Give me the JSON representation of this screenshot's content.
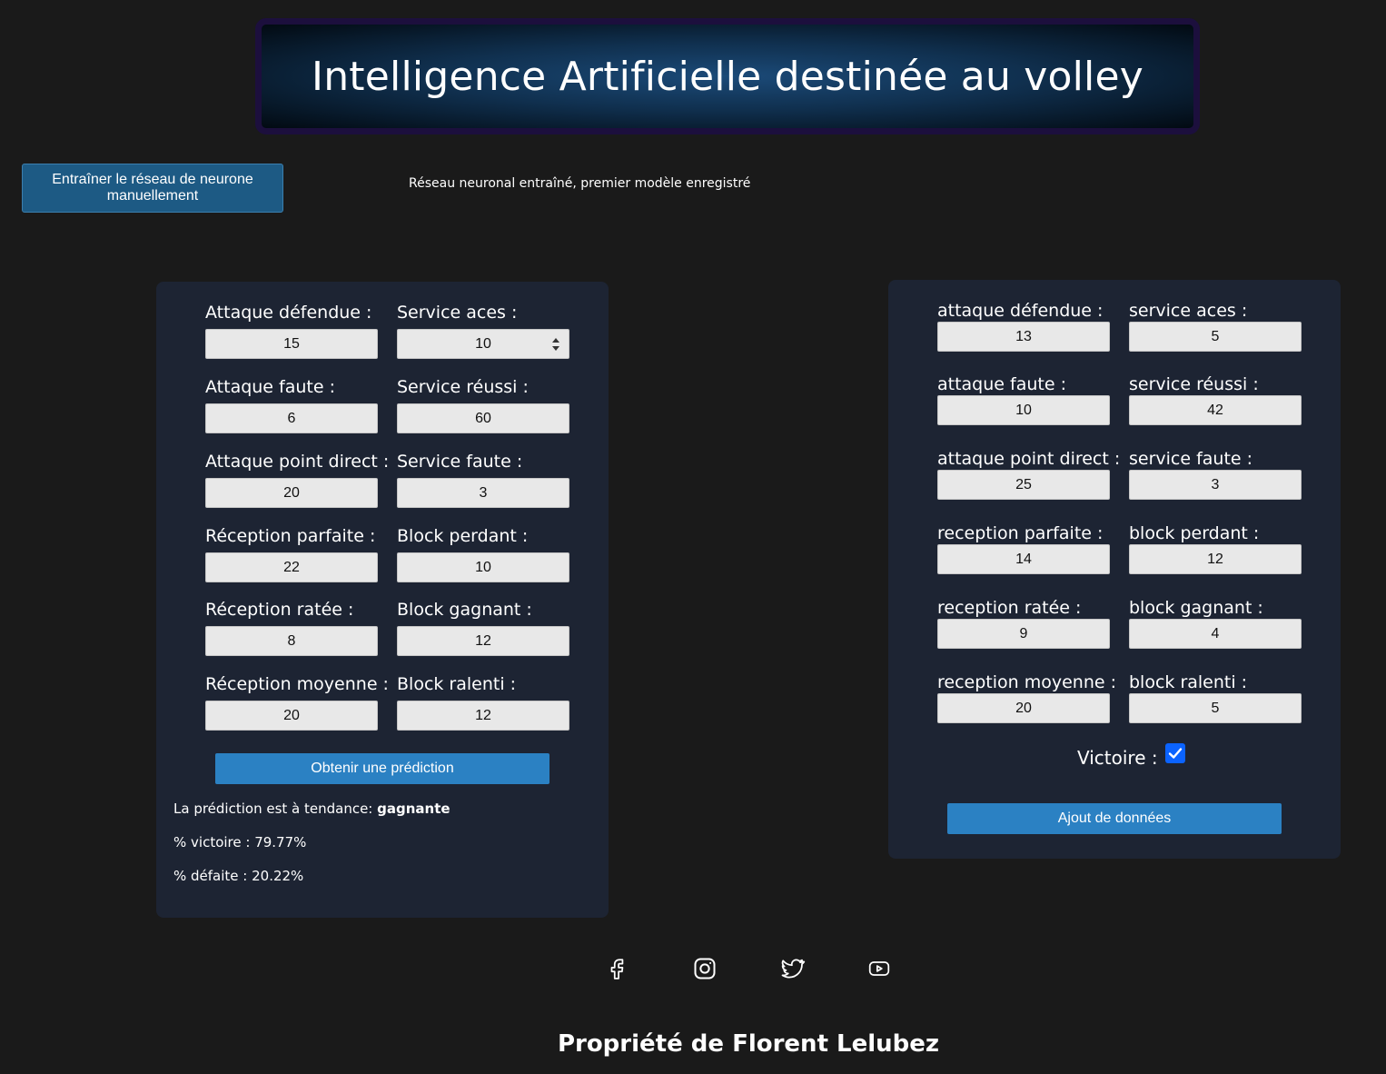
{
  "header": {
    "title": "Intelligence Artificielle destinée au volley"
  },
  "train_button": {
    "label": "Entraîner le réseau de neurone manuellement"
  },
  "status_text": "Réseau neuronal entraîné, premier modèle enregistré",
  "prediction_form": {
    "fields": [
      {
        "label": "Attaque défendue :",
        "value": "15"
      },
      {
        "label": "Service aces :",
        "value": "10"
      },
      {
        "label": "Attaque faute :",
        "value": "6"
      },
      {
        "label": "Service réussi :",
        "value": "60"
      },
      {
        "label": "Attaque point direct :",
        "value": "20"
      },
      {
        "label": "Service faute :",
        "value": "3"
      },
      {
        "label": "Réception parfaite :",
        "value": "22"
      },
      {
        "label": "Block perdant :",
        "value": "10"
      },
      {
        "label": "Réception ratée :",
        "value": "8"
      },
      {
        "label": "Block gagnant :",
        "value": "12"
      },
      {
        "label": "Réception moyenne :",
        "value": "20"
      },
      {
        "label": "Block ralenti :",
        "value": "12"
      }
    ],
    "button_label": "Obtenir une prédiction",
    "result_prefix": "La prédiction est à tendance: ",
    "result_value": "gagnante",
    "win_pct": "% victoire : 79.77%",
    "loss_pct": "% défaite : 20.22%"
  },
  "data_form": {
    "fields": [
      {
        "label": "attaque défendue :",
        "value": "13"
      },
      {
        "label": "service aces :",
        "value": "5"
      },
      {
        "label": "attaque faute :",
        "value": "10"
      },
      {
        "label": "service réussi :",
        "value": "42"
      },
      {
        "label": "attaque point direct :",
        "value": "25"
      },
      {
        "label": "service faute :",
        "value": "3"
      },
      {
        "label": "reception parfaite :",
        "value": "14"
      },
      {
        "label": "block perdant :",
        "value": "12"
      },
      {
        "label": "reception ratée :",
        "value": "9"
      },
      {
        "label": "block gagnant :",
        "value": "4"
      },
      {
        "label": "reception moyenne :",
        "value": "20"
      },
      {
        "label": "block ralenti :",
        "value": "5"
      }
    ],
    "victoire_label": "Victoire :",
    "victoire_checked": true,
    "button_label": "Ajout de données"
  },
  "socials": [
    "facebook-icon",
    "instagram-icon",
    "twitter-icon",
    "youtube-icon"
  ],
  "footer": {
    "text": "Propriété de Florent Lelubez"
  },
  "colors": {
    "background": "#1a1a1a",
    "card": "#1d2433",
    "button": "#2b81c3",
    "checkbox": "#0b63ff"
  }
}
